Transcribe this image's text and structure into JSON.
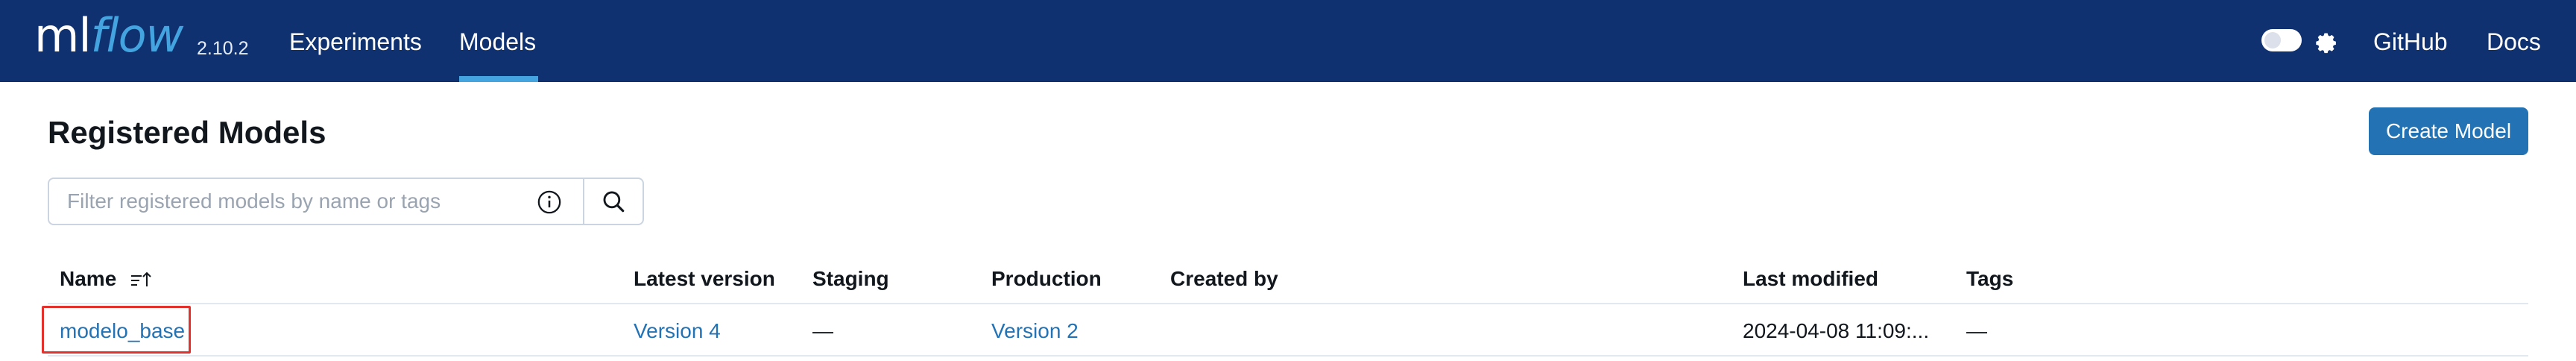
{
  "app": {
    "logo_ml": "ml",
    "logo_flow": "flow",
    "version": "2.10.2"
  },
  "nav": {
    "experiments": "Experiments",
    "models": "Models",
    "github": "GitHub",
    "docs": "Docs"
  },
  "page": {
    "title": "Registered Models",
    "create_button": "Create Model"
  },
  "search": {
    "placeholder": "Filter registered models by name or tags",
    "value": ""
  },
  "table": {
    "columns": {
      "name": "Name",
      "latest_version": "Latest version",
      "staging": "Staging",
      "production": "Production",
      "created_by": "Created by",
      "last_modified": "Last modified",
      "tags": "Tags"
    },
    "rows": [
      {
        "name": "modelo_base",
        "latest_version": "Version 4",
        "staging": "—",
        "production": "Version 2",
        "created_by": "",
        "last_modified": "2024-04-08 11:09:...",
        "tags": "—"
      }
    ]
  },
  "colors": {
    "header_bg": "#0f3170",
    "accent": "#43a4e0",
    "primary_button": "#2272b4",
    "link": "#2272b4",
    "highlight": "#e2322e"
  },
  "icons": {
    "theme_toggle": "toggle-switch",
    "settings": "gear-icon",
    "info": "info-icon",
    "search": "search-icon",
    "sort": "sort-ascending-icon"
  }
}
